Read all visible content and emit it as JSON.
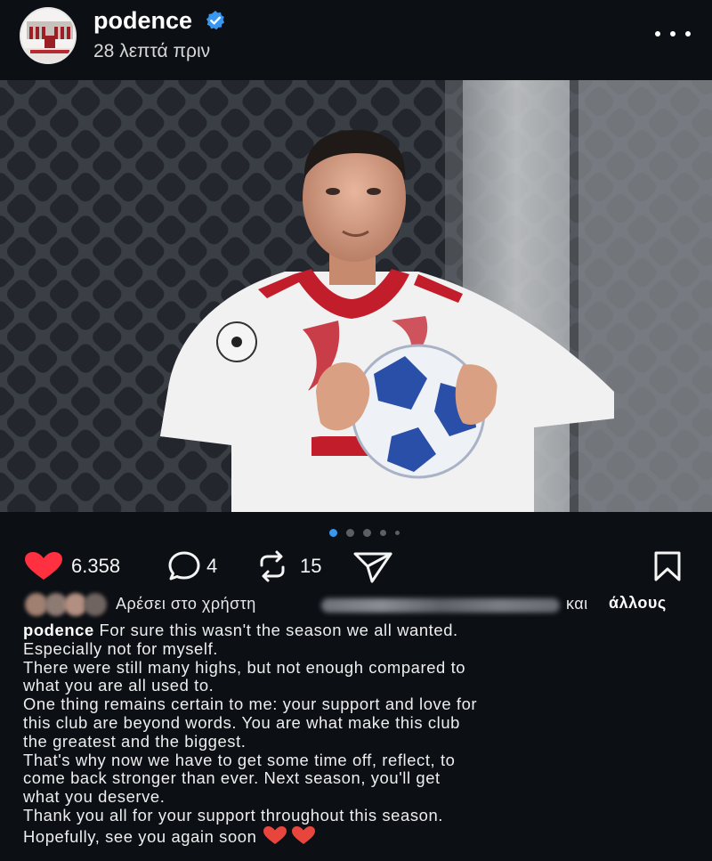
{
  "post": {
    "username": "podence",
    "timestamp": "28 λεπτά πριν",
    "verified": true,
    "accent_color": "#3897f0"
  },
  "media": {
    "carousel_count": 5,
    "active_index": 0
  },
  "actions": {
    "likes": "6.358",
    "comments": "4",
    "reposts": "15",
    "like_color": "#ff3040"
  },
  "liked_by": {
    "prefix": "Αρέσει στο χρήστη",
    "suffix_plain": "και",
    "suffix_bold": "άλλους"
  },
  "caption": {
    "username": "podence",
    "line1": " For sure this wasn't the season we all wanted.",
    "line2": "Especially not for myself.",
    "line3": "There were still many highs, but not enough compared to",
    "line4": "what you are all used to.",
    "line5": "One thing remains certain to me: your support and love for",
    "line6": "this club are beyond words. You are what make this club",
    "line7": "the greatest and the biggest.",
    "line8": "That's why now we have to get some time off, reflect, to",
    "line9": "come back stronger than ever. Next season, you'll get",
    "line10": "what you deserve.",
    "line11": "Thank you all for your support throughout this season.",
    "line12": "Hopefully, see you again soon "
  }
}
